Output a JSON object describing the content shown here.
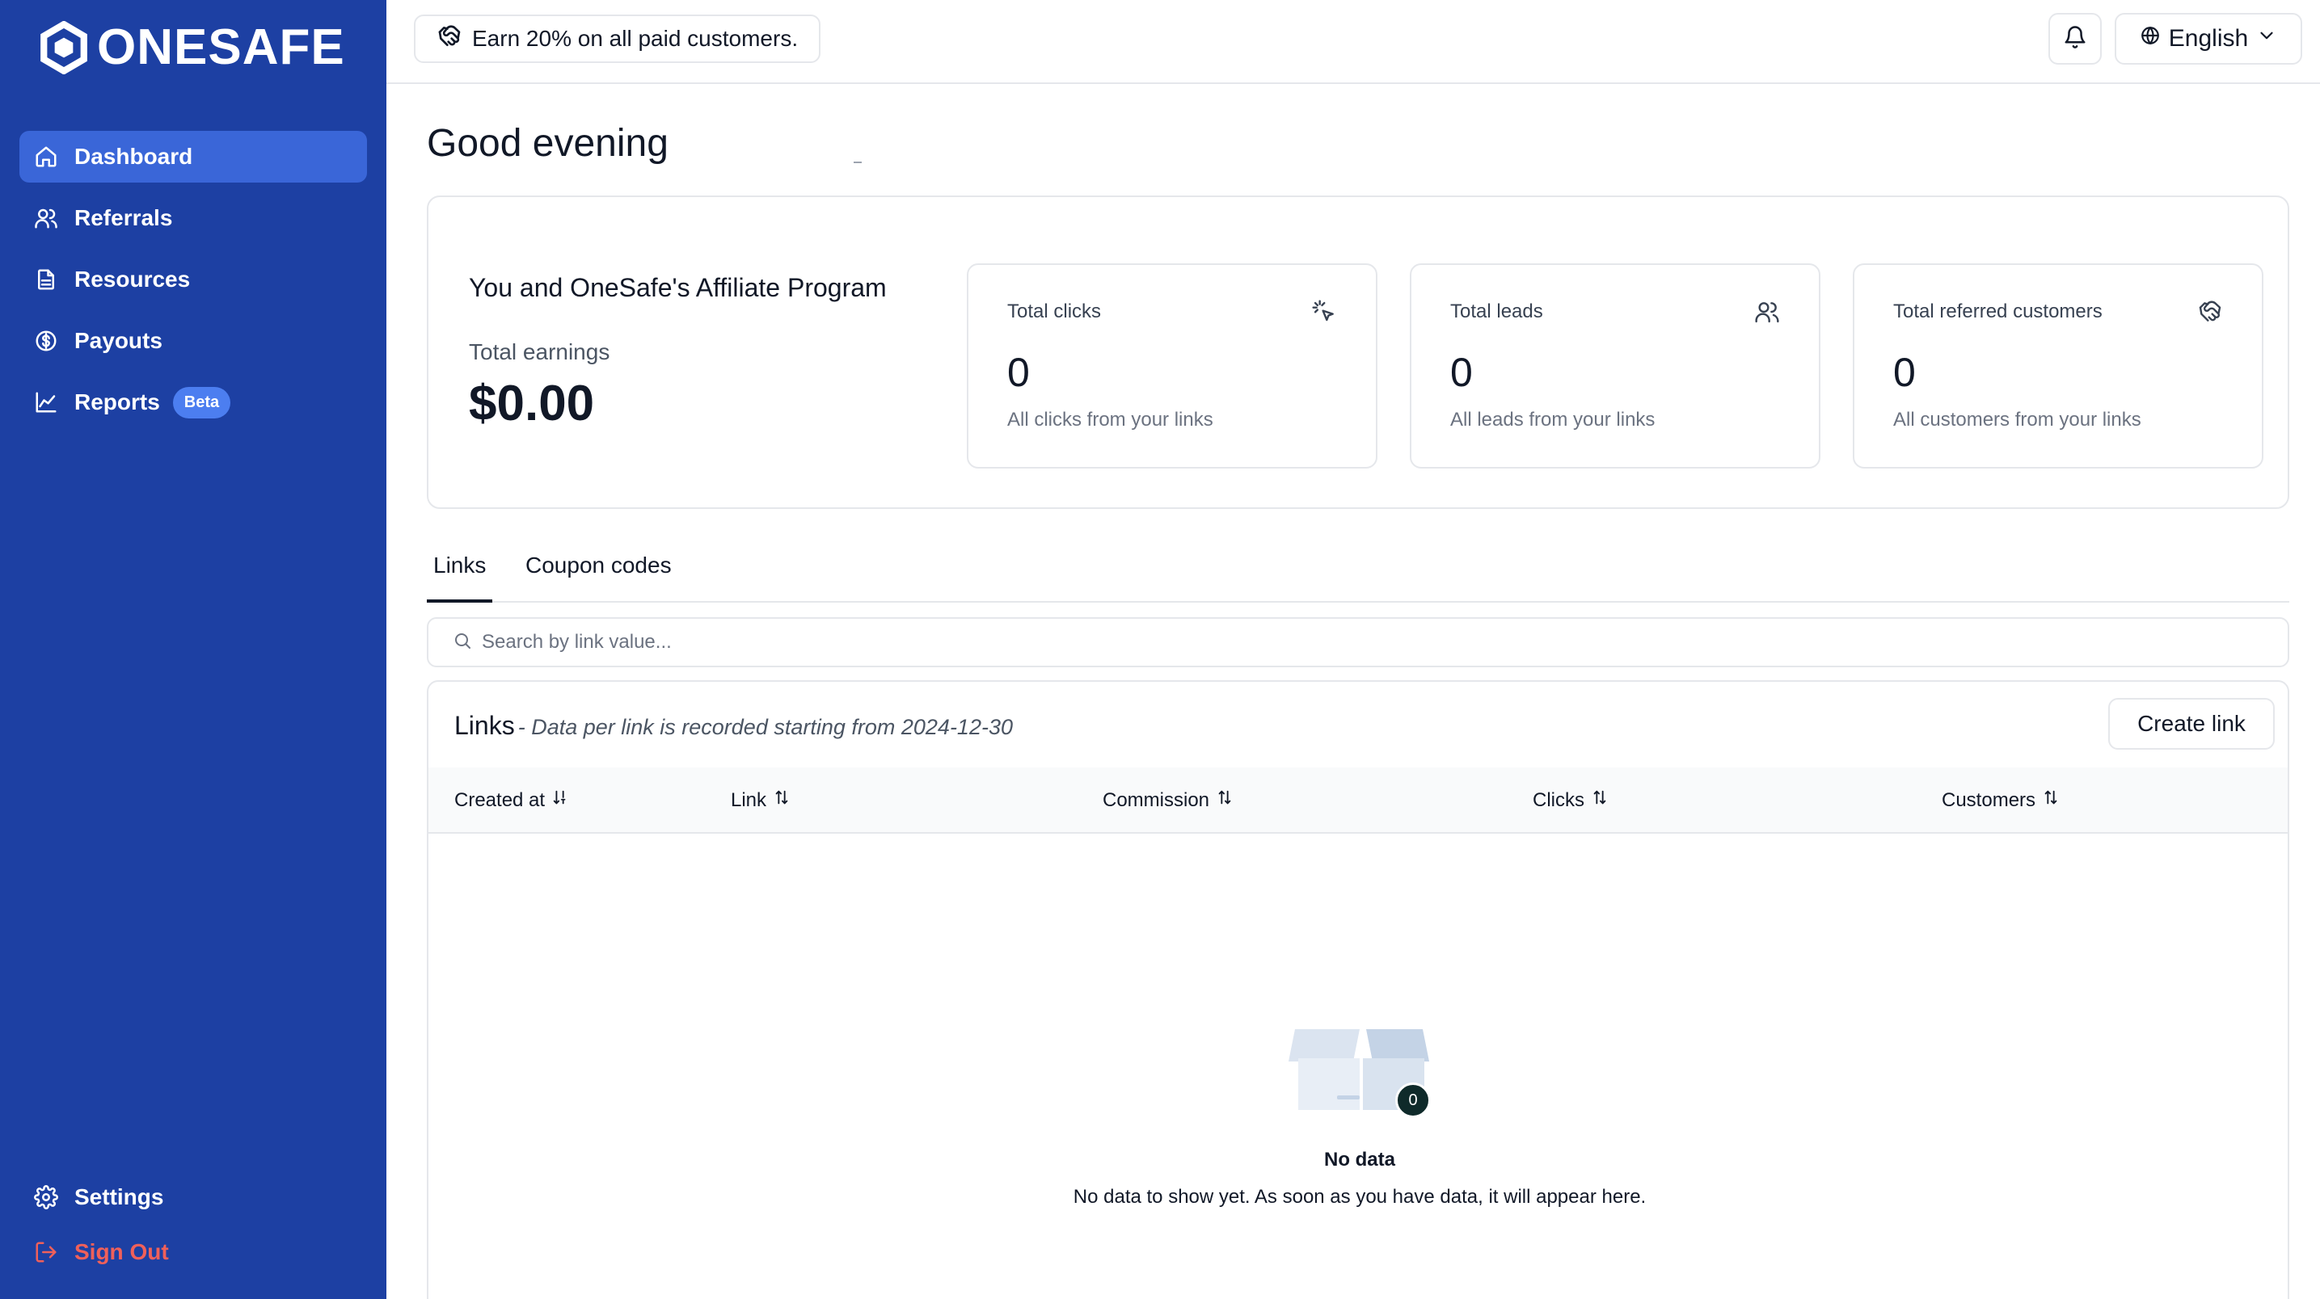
{
  "brand": {
    "name": "ONESAFE"
  },
  "sidebar": {
    "items": [
      {
        "label": "Dashboard",
        "icon": "home-icon",
        "active": true
      },
      {
        "label": "Referrals",
        "icon": "users-icon"
      },
      {
        "label": "Resources",
        "icon": "document-icon"
      },
      {
        "label": "Payouts",
        "icon": "dollar-circle-icon"
      },
      {
        "label": "Reports",
        "icon": "chart-line-icon",
        "badge": "Beta"
      }
    ],
    "bottom": [
      {
        "label": "Settings",
        "icon": "gear-icon"
      },
      {
        "label": "Sign Out",
        "icon": "sign-out-icon"
      }
    ]
  },
  "topbar": {
    "promo": "Earn 20% on all paid customers.",
    "language": "English"
  },
  "greeting": "Good evening",
  "summary": {
    "title": "You and OneSafe's Affiliate Program",
    "earnings_label": "Total earnings",
    "earnings_value": "$0.00",
    "stats": [
      {
        "title": "Total clicks",
        "value": "0",
        "desc": "All clicks from your links",
        "icon": "cursor-click-icon"
      },
      {
        "title": "Total leads",
        "value": "0",
        "desc": "All leads from your links",
        "icon": "users-icon"
      },
      {
        "title": "Total referred customers",
        "value": "0",
        "desc": "All customers from your links",
        "icon": "handshake-icon"
      }
    ]
  },
  "tabs": [
    {
      "label": "Links",
      "active": true
    },
    {
      "label": "Coupon codes"
    }
  ],
  "search": {
    "placeholder": "Search by link value..."
  },
  "links": {
    "title": "Links",
    "subtitle": "- Data per link is recorded starting from 2024-12-30",
    "create_label": "Create link",
    "columns": [
      "Created at",
      "Link",
      "Commission",
      "Clicks",
      "Customers"
    ],
    "empty_count": "0",
    "empty_title": "No data",
    "empty_desc": "No data to show yet. As soon as you have data, it will appear here."
  },
  "colors": {
    "sidebar": "#1d40a3",
    "active_nav": "#3a66d8",
    "signout": "#f0605a"
  }
}
